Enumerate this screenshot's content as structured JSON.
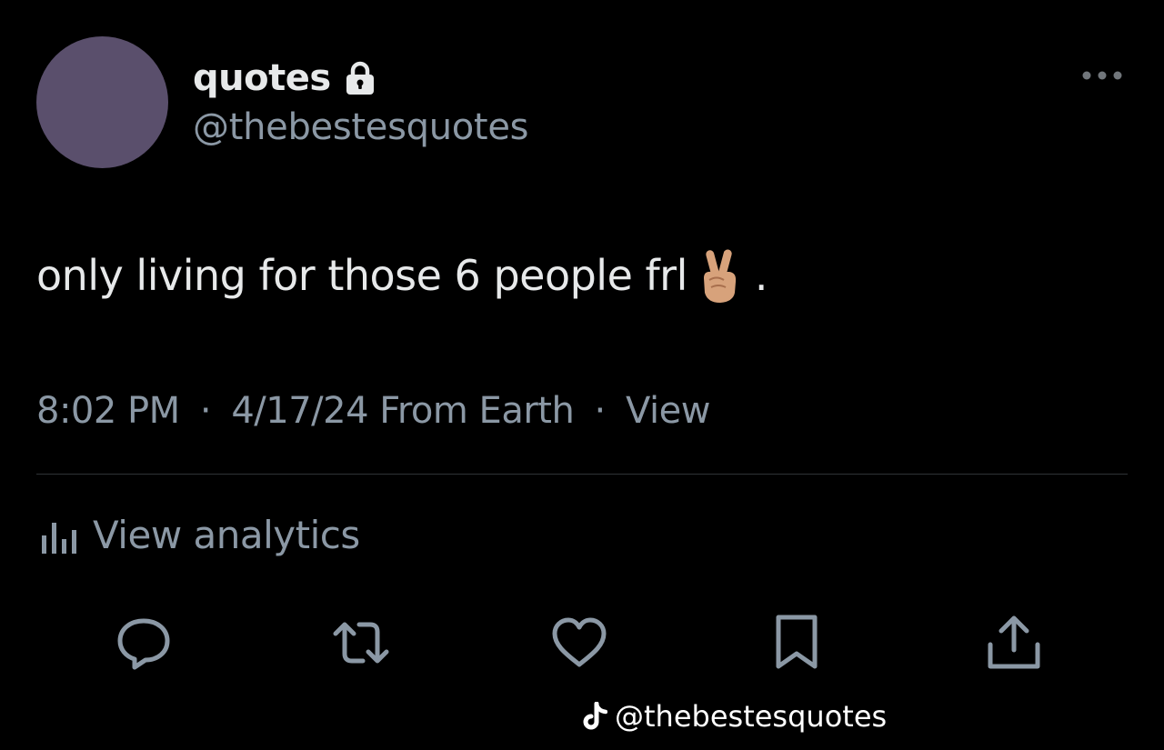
{
  "author": {
    "display_name": "quotes",
    "handle": "@thebestesquotes",
    "avatar_color": "#5a4f6c",
    "protected": true,
    "lock_icon": "lock-icon"
  },
  "tweet": {
    "text": "only living for those 6 people frl",
    "emoji": "victory-hand-emoji",
    "trailing_text": ".",
    "time": "8:02 PM",
    "date": "4/17/24 From Earth",
    "separator": "·",
    "view_label": "View"
  },
  "analytics": {
    "label": "View analytics",
    "icon": "analytics-icon"
  },
  "actions": [
    {
      "name": "reply",
      "icon": "reply-icon"
    },
    {
      "name": "retweet",
      "icon": "retweet-icon"
    },
    {
      "name": "like",
      "icon": "heart-icon"
    },
    {
      "name": "bookmark",
      "icon": "bookmark-icon"
    },
    {
      "name": "share",
      "icon": "share-icon"
    }
  ],
  "watermark": {
    "handle": "@thebestesquotes",
    "icon": "tiktok-icon"
  },
  "colors": {
    "background": "#000000",
    "primary_text": "#e7e9ea",
    "secondary_text": "#8b98a5",
    "divider": "#2f3336"
  }
}
